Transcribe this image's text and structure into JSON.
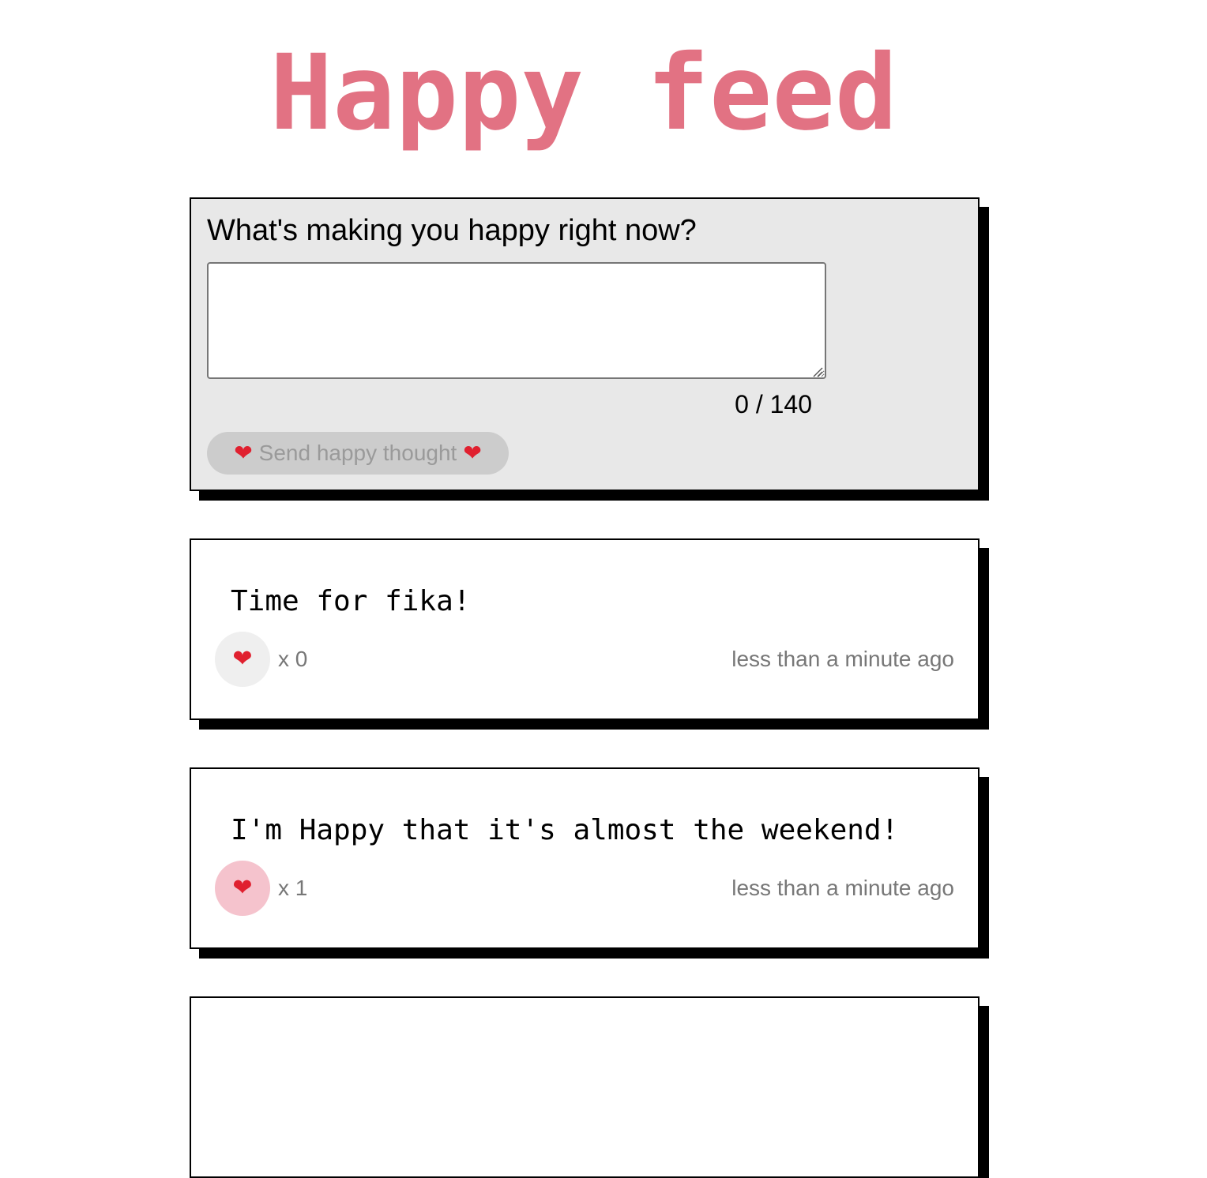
{
  "header": {
    "title": "Happy feed"
  },
  "composer": {
    "label": "What's making you happy right now?",
    "textarea_value": "",
    "char_count": "0 / 140",
    "send_button": {
      "label": "Send happy thought",
      "icon": "heart-icon"
    }
  },
  "posts": [
    {
      "message": "Time for fika!",
      "likes": "x 0",
      "liked": false,
      "time": "less than a minute ago"
    },
    {
      "message": "I'm Happy that it's almost the weekend!",
      "likes": "x 1",
      "liked": true,
      "time": "less than a minute ago"
    },
    {
      "message": "",
      "likes": "",
      "liked": false,
      "time": ""
    }
  ],
  "colors": {
    "title": "#e27283",
    "composer_bg": "#e8e8e8",
    "send_button_bg": "#cccccc",
    "like_bg": "#efefef",
    "liked_bg": "#f5c3cd",
    "heart": "#e0202f"
  }
}
